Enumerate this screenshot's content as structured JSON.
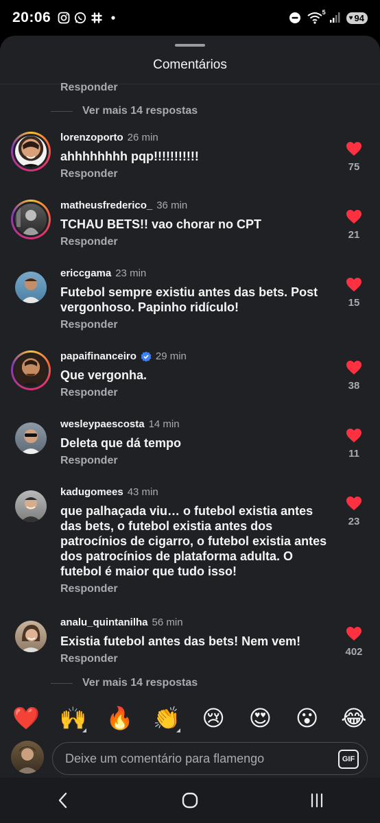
{
  "status_bar": {
    "time": "20:06",
    "battery": "94",
    "wifi_badge": "5"
  },
  "sheet": {
    "title": "Comentários"
  },
  "top_partial": {
    "reply_label": "Responder",
    "more_replies": "Ver mais 14 respostas"
  },
  "comments": [
    {
      "username": "lorenzoporto",
      "time": "26 min",
      "text": "ahhhhhhhh pqp!!!!!!!!!!!",
      "reply": "Responder",
      "likes": "75",
      "ring": true,
      "verified": false
    },
    {
      "username": "matheusfrederico_",
      "time": "36 min",
      "text": "TCHAU BETS!! vao chorar no CPT",
      "reply": "Responder",
      "likes": "21",
      "ring": true,
      "verified": false
    },
    {
      "username": "ericcgama",
      "time": "23 min",
      "text": "Futebol sempre existiu antes das bets. Post vergonhoso. Papinho ridículo!",
      "reply": "Responder",
      "likes": "15",
      "ring": false,
      "verified": false
    },
    {
      "username": "papaifinanceiro",
      "time": "29 min",
      "text": "Que vergonha.",
      "reply": "Responder",
      "likes": "38",
      "ring": true,
      "verified": true
    },
    {
      "username": "wesleypaescosta",
      "time": "14 min",
      "text": "Deleta que dá tempo",
      "reply": "Responder",
      "likes": "11",
      "ring": false,
      "verified": false
    },
    {
      "username": "kadugomees",
      "time": "43 min",
      "text": "que palhaçada viu… o futebol existia antes das bets, o futebol existia antes dos patrocínios de cigarro, o futebol existia antes dos patrocínios de plataforma adulta. O futebol é maior que tudo isso!",
      "reply": "Responder",
      "likes": "23",
      "ring": false,
      "verified": false
    },
    {
      "username": "analu_quintanilha",
      "time": "56 min",
      "text": "Existia futebol antes das bets! Nem vem!",
      "reply": "Responder",
      "likes": "402",
      "ring": false,
      "verified": false
    }
  ],
  "bottom_more_replies": "Ver mais 14 respostas",
  "reactions": [
    "❤️",
    "🙌",
    "🔥",
    "👏",
    "😢",
    "😍",
    "😮",
    "😂"
  ],
  "composer": {
    "placeholder": "Deixe um comentário para flamengo",
    "gif_label": "GIF"
  },
  "colors": {
    "like": "#ff3040",
    "sheet_bg": "#1f2125",
    "muted": "#a8abb1",
    "verified": "#3b82f6"
  }
}
